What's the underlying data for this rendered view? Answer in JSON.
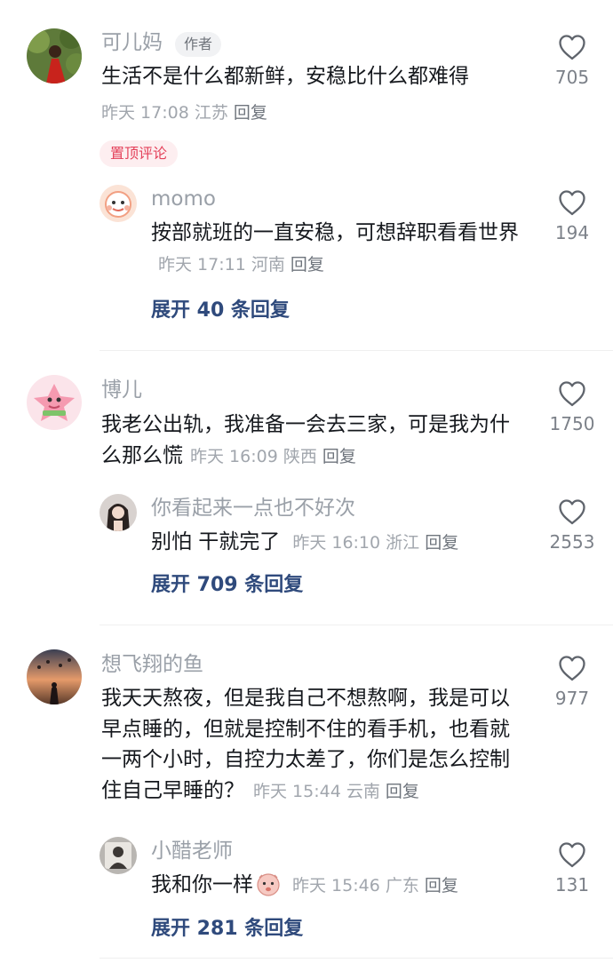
{
  "comments": [
    {
      "user": "可儿妈",
      "author_badge": "作者",
      "text": "生活不是什么都新鲜，安稳比什么都难得",
      "time": "昨天 17:08",
      "location": "江苏",
      "reply_label": "回复",
      "likes": "705",
      "pinned_label": "置顶评论",
      "reply": {
        "user": "momo",
        "text": "按部就班的一直安稳，可想辞职看看世界",
        "time": "昨天 17:11",
        "location": "河南",
        "reply_label": "回复",
        "likes": "194"
      },
      "expand": "展开 40 条回复"
    },
    {
      "user": "博儿",
      "text": "我老公出轨，我准备一会去三家，可是我为什么那么慌",
      "time": "昨天 16:09",
      "location": "陕西",
      "reply_label": "回复",
      "likes": "1750",
      "reply": {
        "user": "你看起来一点也不好次",
        "text": "别怕 干就完了",
        "time": "昨天 16:10",
        "location": "浙江",
        "reply_label": "回复",
        "likes": "2553"
      },
      "expand": "展开 709 条回复"
    },
    {
      "user": "想飞翔的鱼",
      "text": "我天天熬夜，但是我自己不想熬啊，我是可以早点睡的，但就是控制不住的看手机，也看就一两个小时，自控力太差了，你们是怎么控制住自己早睡的？",
      "time": "昨天 15:44",
      "location": "云南",
      "reply_label": "回复",
      "likes": "977",
      "reply": {
        "user": "小醋老师",
        "text": "我和你一样",
        "time": "昨天 15:46",
        "location": "广东",
        "reply_label": "回复",
        "likes": "131"
      },
      "expand": "展开 281 条回复"
    }
  ]
}
